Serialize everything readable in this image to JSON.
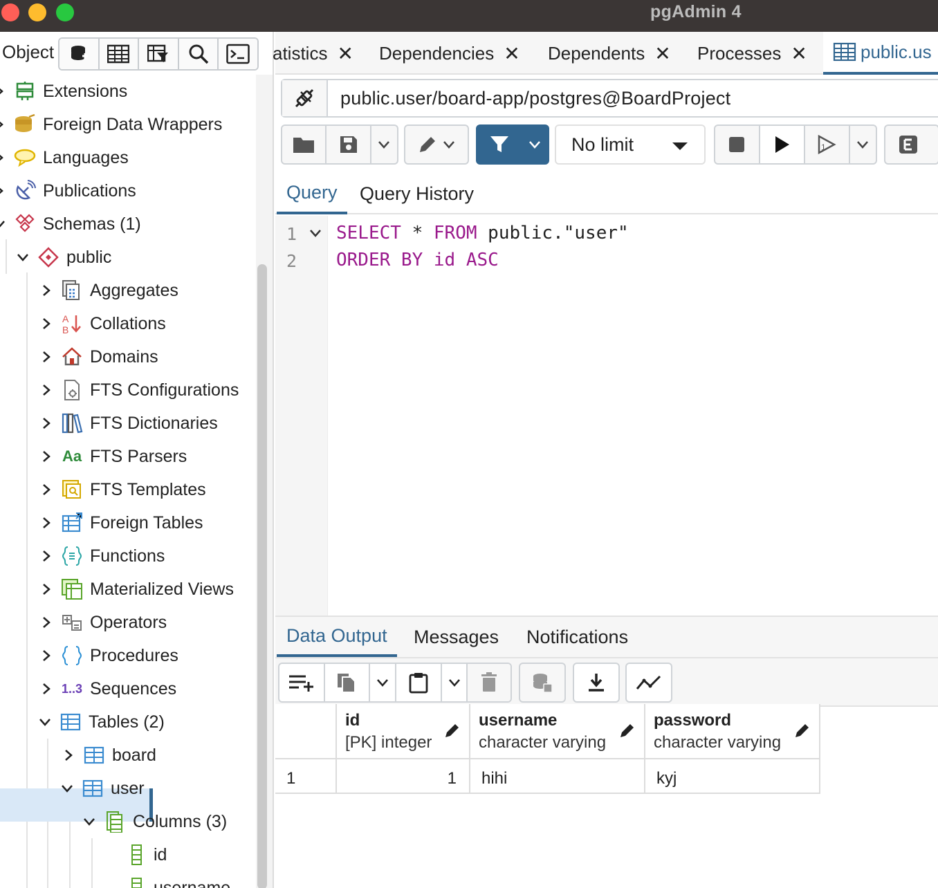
{
  "window": {
    "title": "pgAdmin 4"
  },
  "object_explorer": {
    "label": "Object",
    "tree": {
      "extensions": "Extensions",
      "fdw": "Foreign Data Wrappers",
      "languages": "Languages",
      "publications": "Publications",
      "schemas": "Schemas (1)",
      "public": "public",
      "aggregates": "Aggregates",
      "collations": "Collations",
      "domains": "Domains",
      "fts_configurations": "FTS Configurations",
      "fts_dictionaries": "FTS Dictionaries",
      "fts_parsers": "FTS Parsers",
      "fts_templates": "FTS Templates",
      "foreign_tables": "Foreign Tables",
      "functions": "Functions",
      "materialized_views": "Materialized Views",
      "operators": "Operators",
      "procedures": "Procedures",
      "sequences": "Sequences",
      "tables": "Tables (2)",
      "board": "board",
      "user": "user",
      "columns": "Columns (3)",
      "col_id": "id",
      "col_username": "username"
    },
    "icon_glyphs": {
      "fts_parsers": "Aa",
      "sequences": "1..3"
    }
  },
  "tabs": {
    "statistics": "atistics",
    "dependencies": "Dependencies",
    "dependents": "Dependents",
    "processes": "Processes",
    "query_tab": "public.us"
  },
  "connection": "public.user/board-app/postgres@BoardProject",
  "toolbar": {
    "limit": "No limit"
  },
  "editor_tabs": {
    "query": "Query",
    "history": "Query History"
  },
  "editor": {
    "line_numbers": [
      "1",
      "2"
    ],
    "line1": {
      "kw1": "SELECT",
      "rest1": " * ",
      "kw2": "FROM",
      "rest2": " public.\"user\""
    },
    "line2": {
      "kw1": "ORDER BY",
      "rest1": " ",
      "kw2": "id ASC"
    }
  },
  "output_tabs": {
    "data": "Data Output",
    "messages": "Messages",
    "notifications": "Notifications"
  },
  "result": {
    "columns": [
      {
        "name": "id",
        "type": "[PK] integer"
      },
      {
        "name": "username",
        "type": "character varying"
      },
      {
        "name": "password",
        "type": "character varying"
      }
    ],
    "rows": [
      {
        "row_num": "1",
        "id": "1",
        "username": "hihi",
        "password": "kyj"
      }
    ]
  },
  "colors": {
    "accent": "#326690",
    "keyword": "#9a1a8c",
    "titlebar": "#3b3635",
    "selection": "#d9e8f7"
  }
}
